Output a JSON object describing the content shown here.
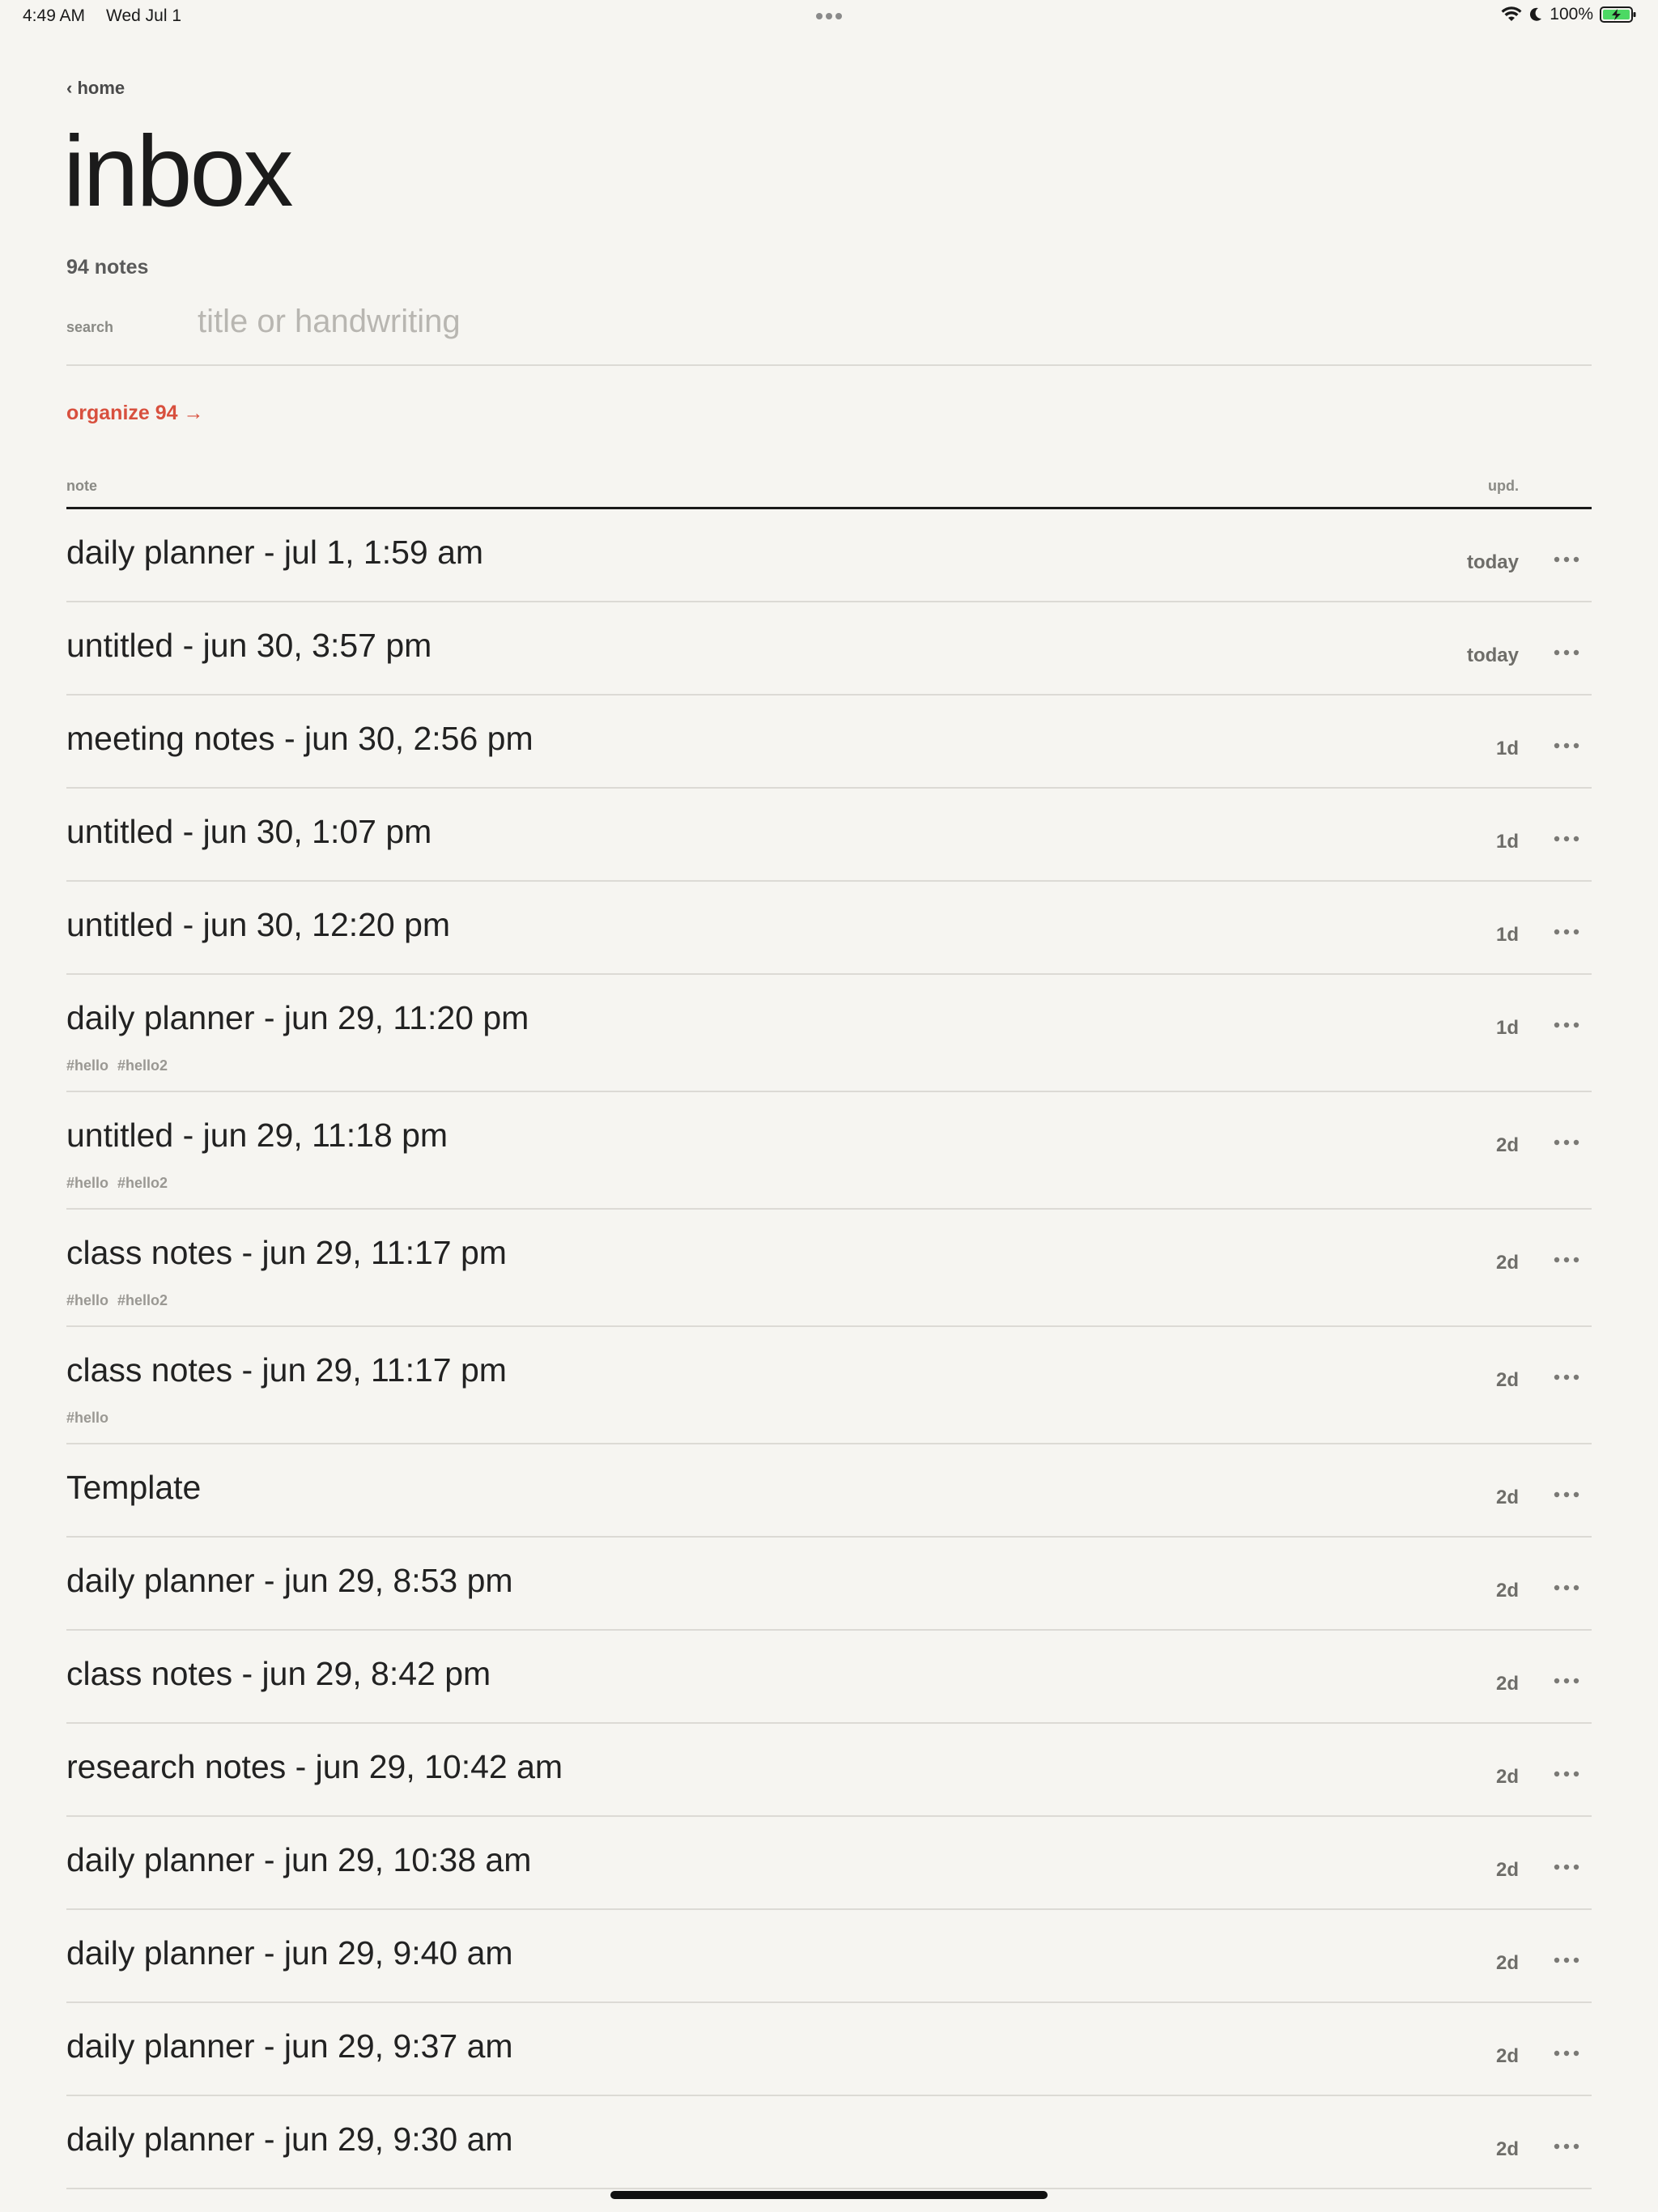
{
  "status_bar": {
    "time": "4:49 AM",
    "date": "Wed Jul 1",
    "battery": "100%"
  },
  "nav": {
    "back_label": "‹ home"
  },
  "page": {
    "title": "inbox",
    "count": "94 notes"
  },
  "search": {
    "label": "search",
    "placeholder": "title or handwriting"
  },
  "organize": {
    "label": "organize 94 →"
  },
  "list": {
    "col_note": "note",
    "col_upd": "upd.",
    "notes": [
      {
        "title": "daily planner - jul 1, 1:59 am",
        "upd": "today",
        "tags": ""
      },
      {
        "title": "untitled - jun 30, 3:57 pm",
        "upd": "today",
        "tags": ""
      },
      {
        "title": "meeting notes - jun 30, 2:56 pm",
        "upd": "1d",
        "tags": ""
      },
      {
        "title": "untitled - jun 30, 1:07 pm",
        "upd": "1d",
        "tags": ""
      },
      {
        "title": "untitled - jun 30, 12:20 pm",
        "upd": "1d",
        "tags": ""
      },
      {
        "title": "daily planner - jun 29, 11:20 pm",
        "upd": "1d",
        "tags": "#hello #hello2"
      },
      {
        "title": "untitled - jun 29, 11:18 pm",
        "upd": "2d",
        "tags": "#hello #hello2"
      },
      {
        "title": "class notes - jun 29, 11:17 pm",
        "upd": "2d",
        "tags": "#hello #hello2"
      },
      {
        "title": "class notes - jun 29, 11:17 pm",
        "upd": "2d",
        "tags": "#hello"
      },
      {
        "title": "Template",
        "upd": "2d",
        "tags": ""
      },
      {
        "title": "daily planner - jun 29, 8:53 pm",
        "upd": "2d",
        "tags": ""
      },
      {
        "title": "class notes - jun 29, 8:42 pm",
        "upd": "2d",
        "tags": ""
      },
      {
        "title": "research notes - jun 29, 10:42 am",
        "upd": "2d",
        "tags": ""
      },
      {
        "title": "daily planner - jun 29, 10:38 am",
        "upd": "2d",
        "tags": ""
      },
      {
        "title": "daily planner - jun 29, 9:40 am",
        "upd": "2d",
        "tags": ""
      },
      {
        "title": "daily planner - jun 29, 9:37 am",
        "upd": "2d",
        "tags": ""
      },
      {
        "title": "daily planner - jun 29, 9:30 am",
        "upd": "2d",
        "tags": ""
      }
    ]
  },
  "colors": {
    "background": "#f6f5f1",
    "accent": "#d8503e",
    "divider": "#dcdad5",
    "battery_fill": "#4cd964"
  }
}
